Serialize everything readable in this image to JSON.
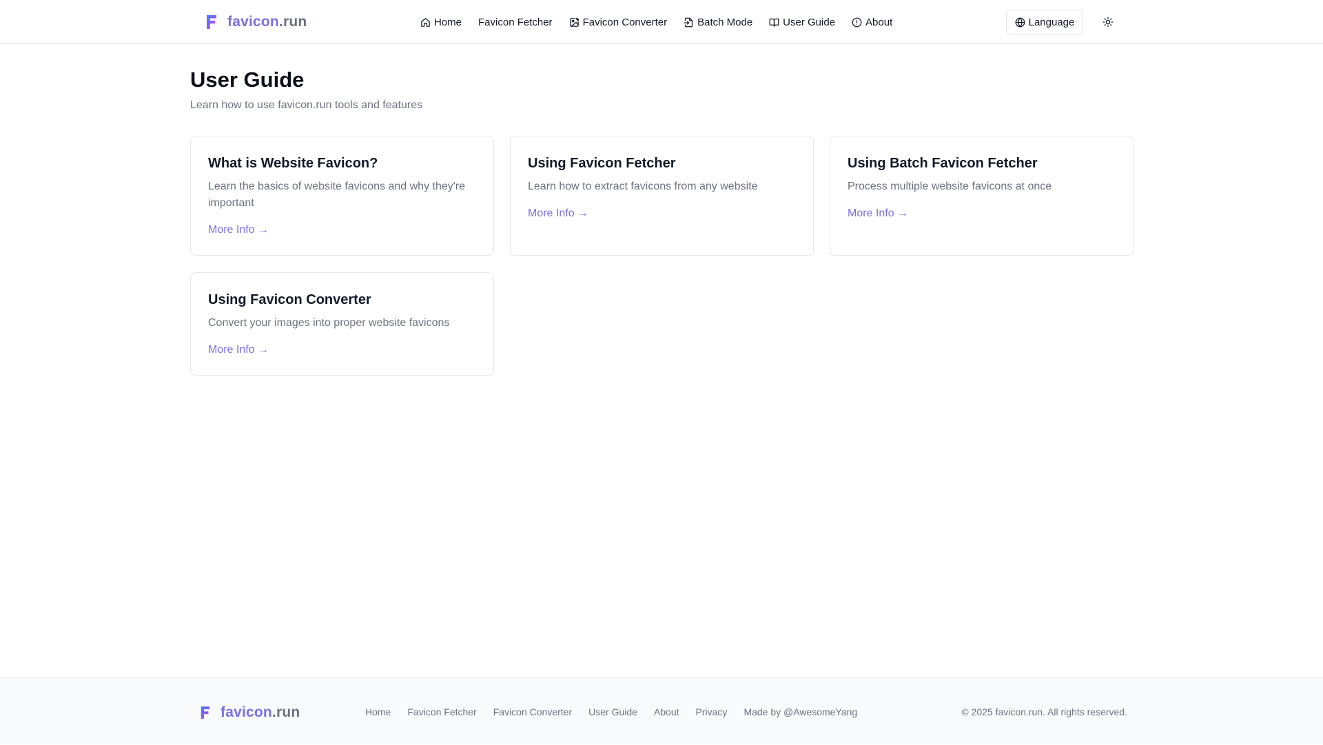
{
  "header": {
    "logo": {
      "text_a": "favicon",
      "text_b": ".run",
      "icon": "logo-f-icon"
    },
    "nav": [
      {
        "label": "Home",
        "icon": "home-icon"
      },
      {
        "label": "Favicon Fetcher",
        "icon": ""
      },
      {
        "label": "Favicon Converter",
        "icon": "image-edit-icon"
      },
      {
        "label": "Batch Mode",
        "icon": "file-import-icon"
      },
      {
        "label": "User Guide",
        "icon": "book-open-icon"
      },
      {
        "label": "About",
        "icon": "info-icon"
      }
    ],
    "language_label": "Language",
    "theme_icon": "sun-icon"
  },
  "main": {
    "title": "User Guide",
    "subtitle": "Learn how to use favicon.run tools and features",
    "cards": [
      {
        "title": "What is Website Favicon?",
        "description": "Learn the basics of website favicons and why they're important",
        "link": "More Info →"
      },
      {
        "title": "Using Favicon Fetcher",
        "description": "Learn how to extract favicons from any website",
        "link": "More Info →"
      },
      {
        "title": "Using Batch Favicon Fetcher",
        "description": "Process multiple website favicons at once",
        "link": "More Info →"
      },
      {
        "title": "Using Favicon Converter",
        "description": "Convert your images into proper website favicons",
        "link": "More Info →"
      }
    ]
  },
  "footer": {
    "logo": {
      "text_a": "favicon",
      "text_b": ".run"
    },
    "links": [
      "Home",
      "Favicon Fetcher",
      "Favicon Converter",
      "User Guide",
      "About",
      "Privacy",
      "Made by @AwesomeYang"
    ],
    "copyright": "© 2025 favicon.run. All rights reserved."
  },
  "colors": {
    "accent": "#7c6fe0",
    "muted": "#6b7280",
    "border": "#e5e7eb",
    "footer_bg": "#f8fafc"
  }
}
